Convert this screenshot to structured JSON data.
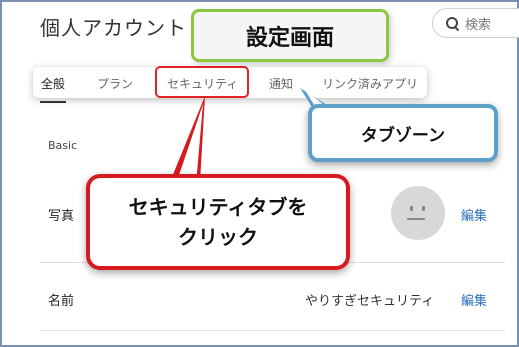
{
  "header": {
    "title": "個人アカウント",
    "search_placeholder": "検索"
  },
  "tabs": [
    {
      "label": "全般",
      "active": true
    },
    {
      "label": "プラン",
      "active": false
    },
    {
      "label": "セキュリティ",
      "active": false
    },
    {
      "label": "通知",
      "active": false
    },
    {
      "label": "リンク済みアプリ",
      "active": false
    }
  ],
  "content": {
    "section_label": "Basic",
    "photo_label": "写真",
    "photo_edit": "編集",
    "name_label": "名前",
    "name_value": "やりすぎセキュリティ",
    "name_edit": "編集"
  },
  "annotations": {
    "screen_title": "設定画面",
    "tab_zone": "タブゾーン",
    "click_security_line1": "セキュリティタブを",
    "click_security_line2": "クリック"
  },
  "colors": {
    "title_border": "#8cc63f",
    "tab_zone_border": "#5fa0c8",
    "security_callout": "#d71920",
    "link": "#2a6ebd"
  }
}
